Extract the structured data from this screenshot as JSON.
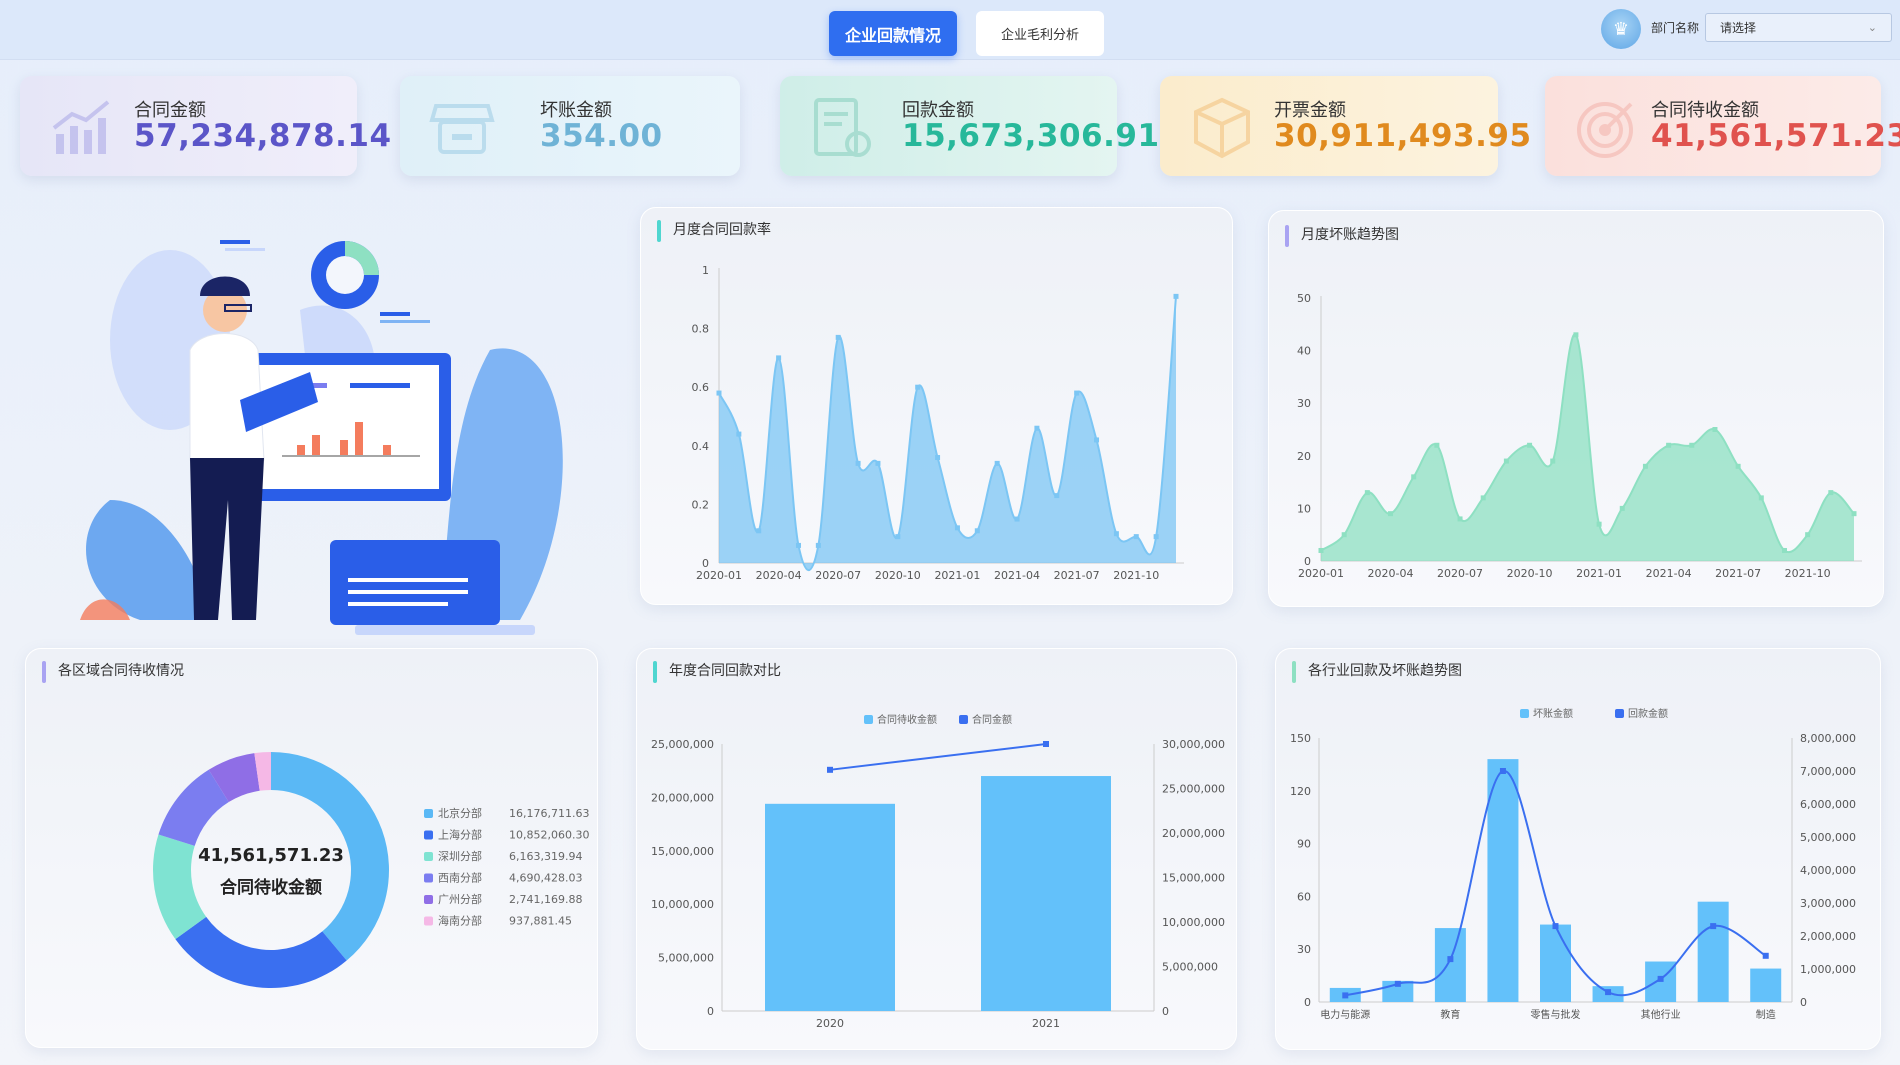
{
  "header": {
    "tab_active": "企业回款情况",
    "tab_inactive": "企业毛利分析",
    "dept_label": "部门名称",
    "dept_select": "请选择"
  },
  "kpis": [
    {
      "label": "合同金额",
      "value": "57,234,878.14",
      "color": "#5b55c8"
    },
    {
      "label": "坏账金额",
      "value": "354.00",
      "color": "#6fb3d6"
    },
    {
      "label": "回款金额",
      "value": "15,673,306.91",
      "color": "#27b89a"
    },
    {
      "label": "开票金额",
      "value": "30,911,493.95",
      "color": "#e08a1e"
    },
    {
      "label": "合同待收金额",
      "value": "41,561,571.23",
      "color": "#e0524e"
    }
  ],
  "chart_data": [
    {
      "id": "monthly_rate",
      "type": "area",
      "title": "月度合同回款率",
      "x": [
        "2020-01",
        "2020-02",
        "2020-03",
        "2020-04",
        "2020-05",
        "2020-06",
        "2020-07",
        "2020-08",
        "2020-09",
        "2020-10",
        "2020-11",
        "2020-12",
        "2021-01",
        "2021-02",
        "2021-03",
        "2021-04",
        "2021-05",
        "2021-06",
        "2021-07",
        "2021-08",
        "2021-09",
        "2021-10",
        "2021-11",
        "2021-12"
      ],
      "x_ticks": [
        "2020-01",
        "2020-04",
        "2020-07",
        "2020-10",
        "2021-01",
        "2021-04",
        "2021-07",
        "2021-10"
      ],
      "values": [
        0.58,
        0.44,
        0.11,
        0.7,
        0.06,
        0.06,
        0.77,
        0.34,
        0.34,
        0.09,
        0.6,
        0.36,
        0.12,
        0.11,
        0.34,
        0.15,
        0.46,
        0.23,
        0.58,
        0.42,
        0.1,
        0.09,
        0.09,
        0.91
      ],
      "ylim": [
        0,
        1
      ],
      "y_ticks": [
        0,
        0.2,
        0.4,
        0.6,
        0.8,
        1
      ],
      "color": "#7cc6f4"
    },
    {
      "id": "bad_debt_trend",
      "type": "area",
      "title": "月度坏账趋势图",
      "x": [
        "2020-01",
        "2020-02",
        "2020-03",
        "2020-04",
        "2020-05",
        "2020-06",
        "2020-07",
        "2020-08",
        "2020-09",
        "2020-10",
        "2020-11",
        "2020-12",
        "2021-01",
        "2021-02",
        "2021-03",
        "2021-04",
        "2021-05",
        "2021-06",
        "2021-07",
        "2021-08",
        "2021-09",
        "2021-10",
        "2021-11",
        "2021-12"
      ],
      "x_ticks": [
        "2020-01",
        "2020-04",
        "2020-07",
        "2020-10",
        "2021-01",
        "2021-04",
        "2021-07",
        "2021-10"
      ],
      "values": [
        2,
        5,
        13,
        9,
        16,
        22,
        8,
        12,
        19,
        22,
        19,
        43,
        7,
        10,
        18,
        22,
        22,
        25,
        18,
        12,
        2,
        5,
        13,
        9
      ],
      "ylim": [
        0,
        50
      ],
      "y_ticks": [
        0,
        10,
        20,
        30,
        40,
        50
      ],
      "color": "#8ee0c2"
    },
    {
      "id": "region_pending",
      "type": "pie",
      "title": "各区域合同待收情况",
      "center_value": "41,561,571.23",
      "center_label": "合同待收金额",
      "categories": [
        "北京分部",
        "上海分部",
        "深圳分部",
        "西南分部",
        "广州分部",
        "海南分部"
      ],
      "values": [
        16176711.63,
        10852060.3,
        6163319.94,
        4690428.03,
        2741169.88,
        937881.45
      ],
      "value_labels": [
        "16,176,711.63",
        "10,852,060.30",
        "6,163,319.94",
        "4,690,428.03",
        "2,741,169.88",
        "937,881.45"
      ],
      "colors": [
        "#5ab8f5",
        "#3a6ff0",
        "#7fe3d2",
        "#7b7df0",
        "#8f6ee6",
        "#f5b8e6"
      ]
    },
    {
      "id": "yearly_compare",
      "type": "bar",
      "title": "年度合同回款对比",
      "categories": [
        "2020",
        "2021"
      ],
      "series": [
        {
          "name": "合同待收金额",
          "kind": "bar",
          "axis": "left",
          "values": [
            19400000,
            22000000
          ],
          "color": "#63c1fa"
        },
        {
          "name": "合同金额",
          "kind": "line",
          "axis": "right",
          "values": [
            27100000,
            30000000
          ],
          "color": "#3a6ff0"
        }
      ],
      "left_ticks": [
        "0",
        "5,000,000",
        "10,000,000",
        "15,000,000",
        "20,000,000",
        "25,000,000"
      ],
      "left_ylim": [
        0,
        25000000
      ],
      "right_ticks": [
        "0",
        "5,000,000",
        "10,000,000",
        "15,000,000",
        "20,000,000",
        "25,000,000",
        "30,000,000"
      ],
      "right_ylim": [
        0,
        30000000
      ]
    },
    {
      "id": "industry_trend",
      "type": "bar",
      "title": "各行业回款及坏账趋势图",
      "categories": [
        "电力与能源",
        "",
        "教育",
        "",
        "零售与批发",
        "",
        "其他行业",
        "",
        "制造"
      ],
      "x_labels": [
        "电力与能源",
        "教育",
        "零售与批发",
        "其他行业",
        "制造"
      ],
      "series": [
        {
          "name": "坏账金额",
          "kind": "bar",
          "axis": "left",
          "values": [
            8,
            12,
            42,
            138,
            44,
            9,
            23,
            57,
            19
          ],
          "color": "#63c1fa"
        },
        {
          "name": "回款金额",
          "kind": "line",
          "axis": "right",
          "values": [
            200000,
            550000,
            1300000,
            7000000,
            2300000,
            300000,
            700000,
            2300000,
            1400000
          ],
          "color": "#3a6ff0"
        }
      ],
      "left_ticks": [
        "0",
        "30",
        "60",
        "90",
        "120",
        "150"
      ],
      "left_ylim": [
        0,
        150
      ],
      "right_ticks": [
        "0",
        "1,000,000",
        "2,000,000",
        "3,000,000",
        "4,000,000",
        "5,000,000",
        "6,000,000",
        "7,000,000",
        "8,000,000"
      ],
      "right_ylim": [
        0,
        8000000
      ]
    }
  ]
}
